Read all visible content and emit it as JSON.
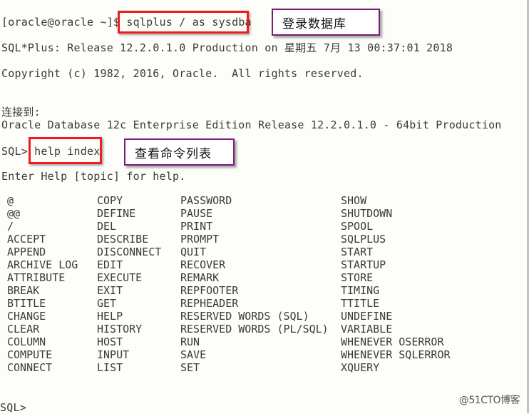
{
  "terminal": {
    "prompt_shell": "[oracle@oracle ~]$ ",
    "command_login": "sqlplus / as sysdba",
    "banner_line": "SQL*Plus: Release 12.2.0.1.0 Production on 星期五 7月 13 00:37:01 2018",
    "copyright_line": "Copyright (c) 1982, 2016, Oracle.  All rights reserved.",
    "connected_to": "连接到:",
    "db_version": "Oracle Database 12c Enterprise Edition Release 12.2.0.1.0 - 64bit Production",
    "sql_prompt": "SQL> ",
    "command_help": "help index",
    "help_hint": "Enter Help [topic] for help.",
    "final_prompt": "SQL>"
  },
  "annotations": {
    "login_label": "登录数据库",
    "help_label": "查看命令列表",
    "highlight_color": "#ee1c1c",
    "callout_border_color": "#7c1a7c"
  },
  "help_topics": {
    "col1": [
      "@",
      "@@",
      "/",
      "ACCEPT",
      "APPEND",
      "ARCHIVE LOG",
      "ATTRIBUTE",
      "BREAK",
      "BTITLE",
      "CHANGE",
      "CLEAR",
      "COLUMN",
      "COMPUTE",
      "CONNECT"
    ],
    "col2": [
      "COPY",
      "DEFINE",
      "DEL",
      "DESCRIBE",
      "DISCONNECT",
      "EDIT",
      "EXECUTE",
      "EXIT",
      "GET",
      "HELP",
      "HISTORY",
      "HOST",
      "INPUT",
      "LIST"
    ],
    "col3": [
      "PASSWORD",
      "PAUSE",
      "PRINT",
      "PROMPT",
      "QUIT",
      "RECOVER",
      "REMARK",
      "REPFOOTER",
      "REPHEADER",
      "RESERVED WORDS (SQL)",
      "RESERVED WORDS (PL/SQL)",
      "RUN",
      "SAVE",
      "SET"
    ],
    "col4": [
      "SHOW",
      "SHUTDOWN",
      "SPOOL",
      "SQLPLUS",
      "START",
      "STARTUP",
      "STORE",
      "TIMING",
      "TTITLE",
      "UNDEFINE",
      "VARIABLE",
      "WHENEVER OSERROR",
      "WHENEVER SQLERROR",
      "XQUERY"
    ]
  },
  "watermark": "@51CTO博客"
}
